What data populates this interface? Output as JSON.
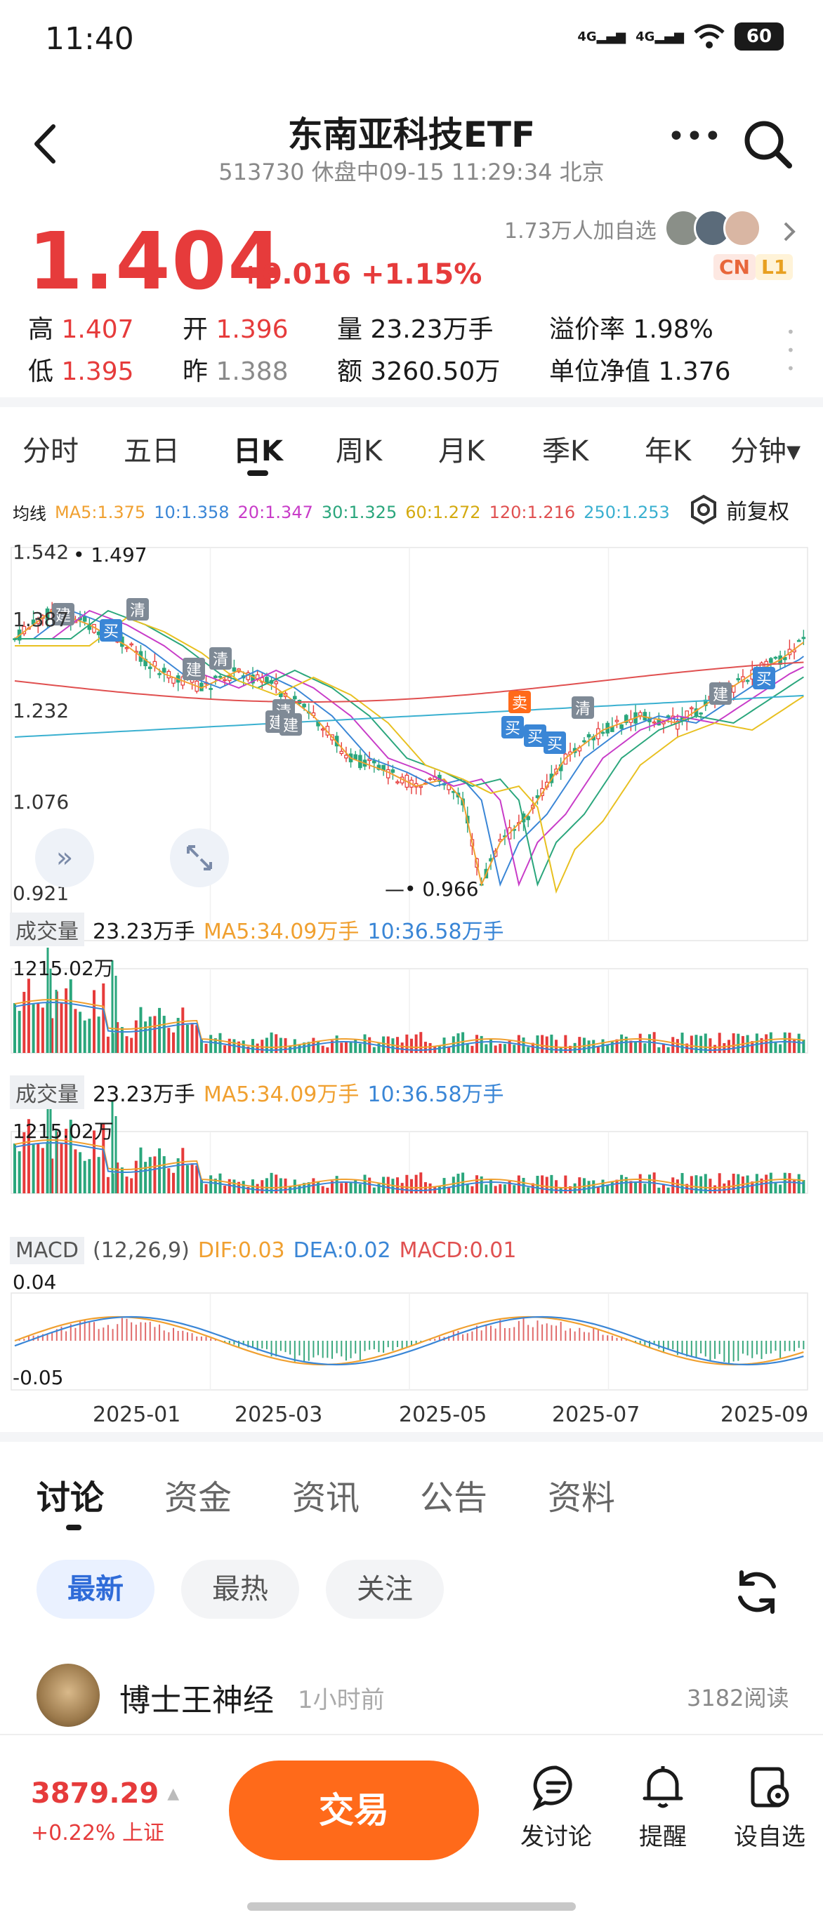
{
  "status_bar": {
    "time": "11:40",
    "net1": "4G",
    "net2": "4G",
    "battery": "60"
  },
  "header": {
    "title": "东南亚科技ETF",
    "subtitle": "513730 休盘中09-15 11:29:34 北京"
  },
  "quote": {
    "price": "1.404",
    "change": "+0.016",
    "change_pct": "+1.15%",
    "followers": "1.73万人加自选",
    "badge_cn": "CN",
    "badge_l1": "L1",
    "high_label": "高",
    "high": "1.407",
    "open_label": "开",
    "open": "1.396",
    "volume_label": "量",
    "volume": "23.23万手",
    "premium_label": "溢价率",
    "premium": "1.98%",
    "low_label": "低",
    "low": "1.395",
    "prev_label": "昨",
    "prev": "1.388",
    "amount_label": "额",
    "amount": "3260.50万",
    "nav_label": "单位净值",
    "nav": "1.376"
  },
  "period_tabs": [
    "分时",
    "五日",
    "日K",
    "周K",
    "月K",
    "季K",
    "年K",
    "分钟▾"
  ],
  "active_period": "日K",
  "ma_legend": {
    "label": "均线",
    "items": [
      {
        "text": "MA5:1.375",
        "color": "#f0a030"
      },
      {
        "text": "10:1.358",
        "color": "#3a86d6"
      },
      {
        "text": "20:1.347",
        "color": "#c83cc8"
      },
      {
        "text": "30:1.325",
        "color": "#2aa67c"
      },
      {
        "text": "60:1.272",
        "color": "#e8c020"
      },
      {
        "text": "120:1.216",
        "color": "#e05050"
      },
      {
        "text": "250:1.253",
        "color": "#3ab0d0"
      }
    ],
    "adjust": "前复权"
  },
  "price_axis": {
    "top": "1.542",
    "l2": "1.387",
    "l3": "1.232",
    "l4": "1.076",
    "bottom": "0.921",
    "max_mark": "1.497",
    "min_mark": "0.966"
  },
  "volume_panel": {
    "label": "成交量",
    "vol": "23.23万手",
    "ma5": "MA5:34.09万手",
    "ma10": "10:36.58万手",
    "axis_max": "1215.02万"
  },
  "macd_panel": {
    "label": "MACD",
    "params": "(12,26,9)",
    "dif": "DIF:0.03",
    "dea": "DEA:0.02",
    "macd": "MACD:0.01",
    "axis_top": "0.04",
    "axis_bottom": "-0.05"
  },
  "date_axis": [
    "2025-01",
    "2025-03",
    "2025-05",
    "2025-07",
    "2025-09"
  ],
  "trade_marks": {
    "build": "建",
    "clear": "清",
    "buy": "买",
    "sell": "卖"
  },
  "discussion_tabs": [
    "讨论",
    "资金",
    "资讯",
    "公告",
    "资料"
  ],
  "filters": [
    "最新",
    "最热",
    "关注"
  ],
  "post": {
    "author": "博士王神经",
    "time": "1小时前",
    "reads": "3182阅读"
  },
  "bottom": {
    "index_value": "3879.29",
    "index_change": "+0.22% 上证",
    "trade": "交易",
    "discuss": "发讨论",
    "remind": "提醒",
    "watch": "设自选"
  },
  "colors": {
    "up": "#e63b3b",
    "down": "#2aa67c",
    "accent": "#ff6a1a",
    "link": "#2f6bd8"
  }
}
